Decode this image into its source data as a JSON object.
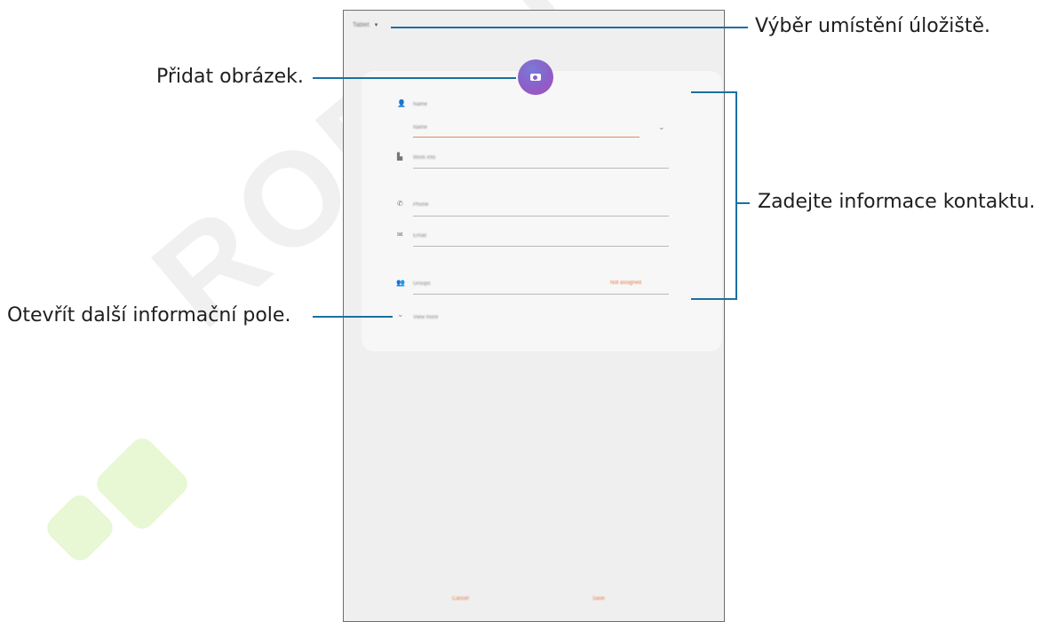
{
  "watermark": "ROBOT WEB",
  "device": {
    "storage_label": "Tablet",
    "form": {
      "name_label": "Name",
      "name_placeholder": "Name",
      "org_label": "Work info",
      "phone_label": "Phone",
      "email_label": "Email",
      "groups_label": "Groups",
      "groups_action": "Not assigned",
      "view_more": "View more"
    },
    "cancel_label": "Cancel",
    "save_label": "Save"
  },
  "callouts": {
    "storage": "Výběr umístění úložiště.",
    "add_image": "Přidat obrázek.",
    "contact_info": "Zadejte informace kontaktu.",
    "more_fields": "Otevřít další informační pole."
  },
  "colors": {
    "callout_line": "#1c6fa1",
    "accent_orange": "#e7763e",
    "avatar_start": "#7a7ad6",
    "avatar_end": "#b24bb5"
  },
  "icons": [
    "person-icon",
    "building-icon",
    "phone-icon",
    "email-icon",
    "group-icon",
    "camera-icon",
    "chevron-down-icon",
    "dropdown-caret-icon"
  ]
}
